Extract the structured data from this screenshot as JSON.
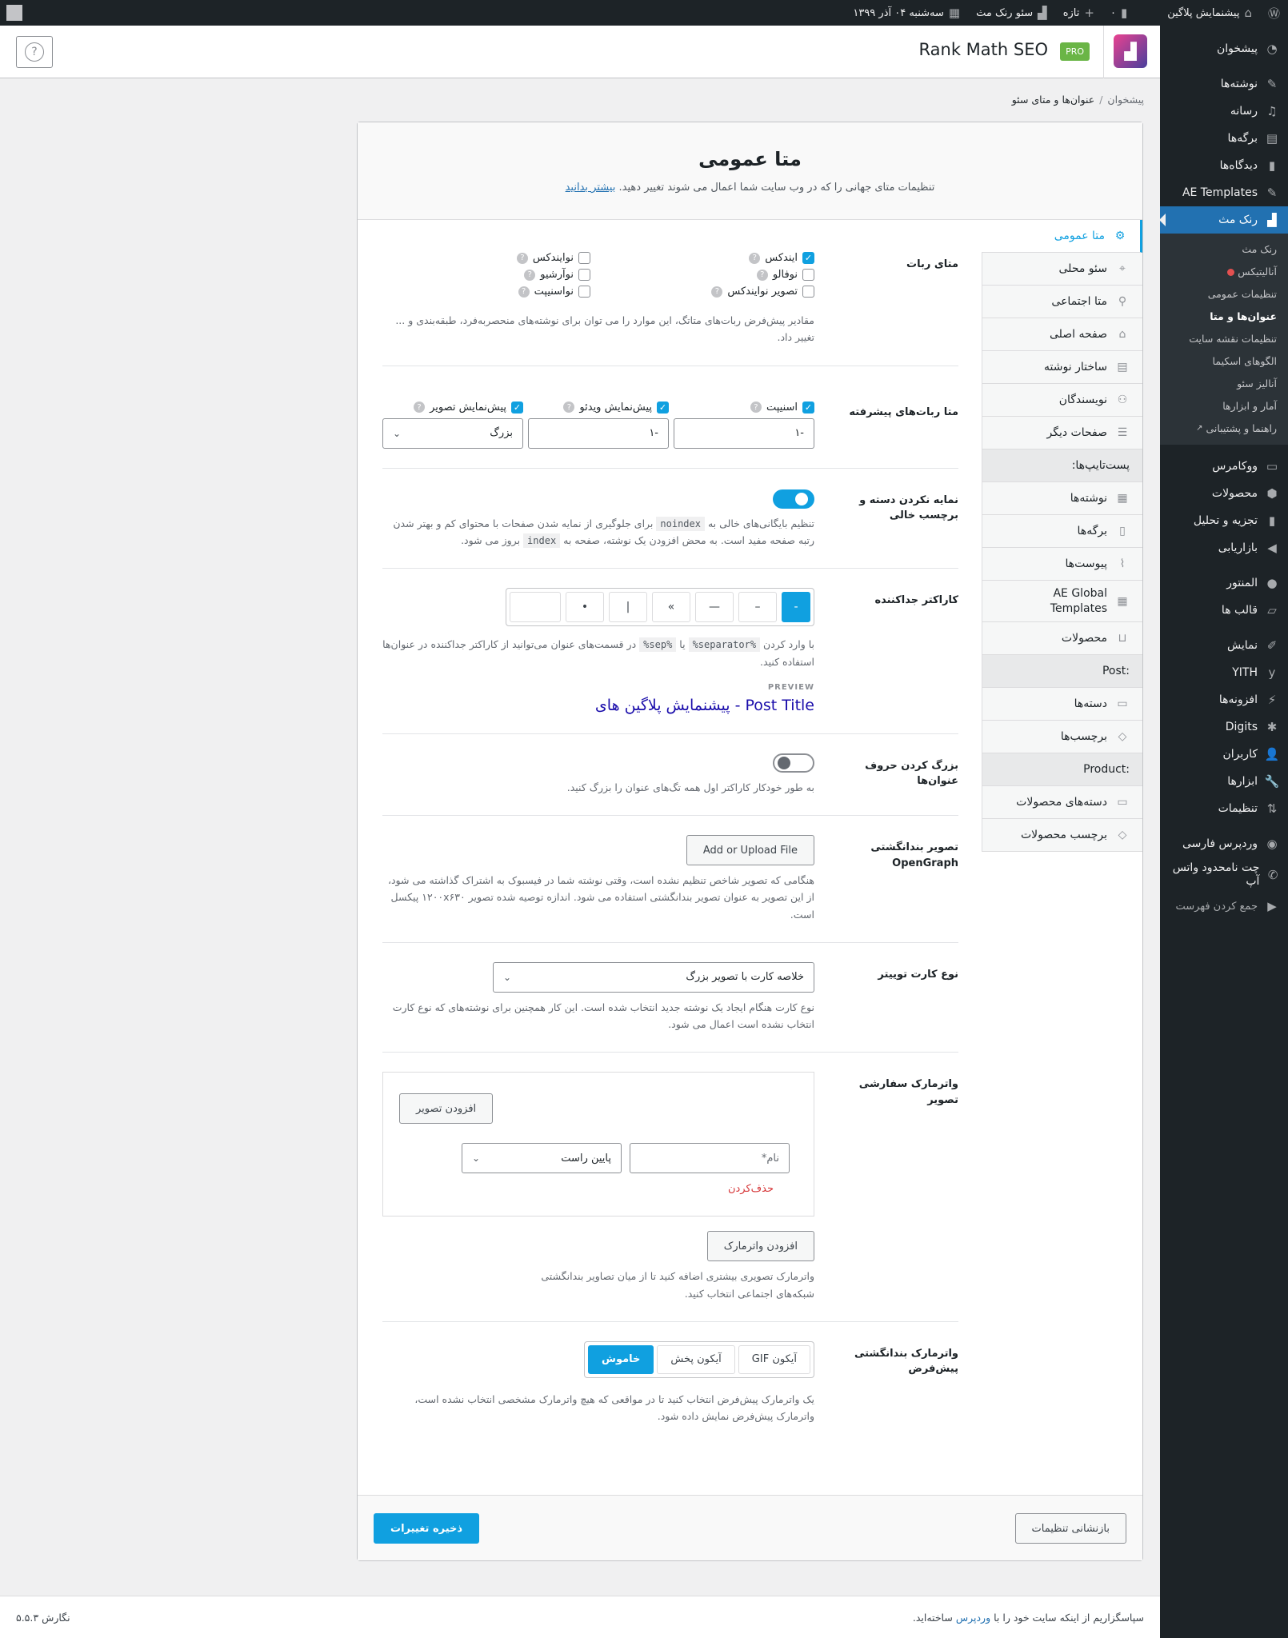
{
  "adminbar": {
    "site_name": "پیشنمایش پلاگین",
    "comments_count": "۰",
    "new_label": "تازه",
    "rankmath_label": "سئو رنک مث",
    "date": "سه‌شنبه ۰۴ آذر ۱۳۹۹"
  },
  "header": {
    "title": "Rank Math SEO",
    "badge": "PRO",
    "help": "?"
  },
  "breadcrumb": {
    "home": "پیشخوان",
    "separator": "/",
    "current": "عنوان‌ها و متای سئو"
  },
  "panel": {
    "title": "متا عمومی",
    "description": "تنظیمات متای جهانی را که در وب سایت شما اعمال می شوند تغییر دهید.",
    "learn_more": "بیشتر بدانید"
  },
  "tabs": [
    {
      "label": "متا عمومی",
      "icon": "gear",
      "active": true
    },
    {
      "label": "سئو محلی",
      "icon": "location"
    },
    {
      "label": "متا اجتماعی",
      "icon": "social"
    },
    {
      "label": "صفحه اصلی",
      "icon": "home"
    },
    {
      "label": "ساختار نوشته",
      "icon": "document"
    },
    {
      "label": "نویسندگان",
      "icon": "users"
    },
    {
      "label": "صفحات دیگر",
      "icon": "list"
    },
    {
      "label": "پست‌تایپ‌ها:",
      "group": true
    },
    {
      "label": "نوشته‌ها",
      "icon": "post"
    },
    {
      "label": "برگه‌ها",
      "icon": "page"
    },
    {
      "label": "پیوست‌ها",
      "icon": "paperclip"
    },
    {
      "label": "AE Global Templates",
      "icon": "post"
    },
    {
      "label": "محصولات",
      "icon": "cart"
    },
    {
      "label": ":Post",
      "group": true
    },
    {
      "label": "دسته‌ها",
      "icon": "folder"
    },
    {
      "label": "برچسب‌ها",
      "icon": "tag"
    },
    {
      "label": ":Product",
      "group": true
    },
    {
      "label": "دسته‌های محصولات",
      "icon": "folder"
    },
    {
      "label": "برچسب محصولات",
      "icon": "tag"
    }
  ],
  "fields": {
    "robots": {
      "label": "متای ربات",
      "options": [
        {
          "label": "ایندکس",
          "checked": true
        },
        {
          "label": "نوایندکس",
          "checked": false
        },
        {
          "label": "نوفالو",
          "checked": false
        },
        {
          "label": "نوآرشیو",
          "checked": false
        },
        {
          "label": "تصویر نوایندکس",
          "checked": false
        },
        {
          "label": "نواسنیپت",
          "checked": false
        }
      ],
      "description": "مقادیر پیش‌فرض ربات‌های متاتگ، این موارد را می توان برای نوشته‌های منحصربه‌فرد، طبقه‌بندی و ... تغییر داد."
    },
    "advanced": {
      "label": "متا ربات‌های پیشرفته",
      "snippet": {
        "label": "اسنیپت",
        "checked": true,
        "value": "-۱"
      },
      "video": {
        "label": "پیش‌نمایش ویدئو",
        "checked": true,
        "value": "-۱"
      },
      "image": {
        "label": "پیش‌نمایش تصویر",
        "checked": true,
        "value": "بزرگ"
      }
    },
    "noindex_empty": {
      "label": "نمایه نکردن دسته و برچسب خالی",
      "enabled": true,
      "desc_pre": "تنظیم بایگانی‌های خالی به",
      "code1": "noindex",
      "desc_mid": "برای جلوگیری از نمایه شدن صفحات با محتوای کم و بهتر شدن رتبه صفحه مفید است. به محض افزودن یک نوشته، صفحه به",
      "code2": "index",
      "desc_post": "بروز می شود."
    },
    "separator": {
      "label": "کاراکتر جداکننده",
      "options": [
        "-",
        "–",
        "—",
        "»",
        "|",
        "•",
        ""
      ],
      "selected": "-",
      "desc_pre": "با وارد کردن",
      "code1": "%separator%",
      "desc_or": "یا",
      "code2": "%sep%",
      "desc_post": "در قسمت‌های عنوان می‌توانید از کاراکتر جداکننده در عنوان‌ها استفاده کنید.",
      "preview_label": "PREVIEW",
      "preview_title": "Post Title - پیشنمایش پلاگین های"
    },
    "capitalize": {
      "label": "بزرگ کردن حروف عنوان‌ها",
      "enabled": false,
      "description": "به طور خودکار کاراکتر اول همه تگ‌های عنوان را بزرگ کنید."
    },
    "opengraph": {
      "label": "تصویر بندانگشتی OpenGraph",
      "button": "Add or Upload File",
      "description": "هنگامی که تصویر شاخص تنظیم نشده است، وقتی نوشته شما در فیسبوک به اشتراک گذاشته می شود، از این تصویر به عنوان تصویر بندانگشتی استفاده می شود. اندازه توصیه شده تصویر ۱۲۰۰x۶۳۰ پیکسل است."
    },
    "twitter": {
      "label": "نوع کارت توییتر",
      "value": "خلاصه کارت با تصویر بزرگ",
      "description": "نوع کارت هنگام ایجاد یک نوشته جدید انتخاب شده است. این کار همچنین برای نوشته‌های که نوع کارت انتخاب نشده است اعمال می شود."
    },
    "watermark": {
      "label": "واترمارک سفارشی تصویر",
      "add_image": "افزودن تصویر",
      "name_placeholder": "نام*",
      "position": "پایین راست",
      "delete": "حذف‌کردن",
      "add_watermark": "افزودن واترمارک",
      "description": "واترمارک تصویری بیشتری اضافه کنید تا از میان تصاویر بندانگشتی شبکه‌های اجتماعی انتخاب کنید."
    },
    "default_watermark": {
      "label": "واترمارک بندانگشتی پیش‌فرض",
      "options": [
        "آیکون GIF",
        "آیکون پخش",
        "خاموش"
      ],
      "selected": "خاموش",
      "description": "یک واترمارک پیش‌فرض انتخاب کنید تا در مواقعی که هیچ واترمارک مشخصی انتخاب نشده است، واترمارک پیش‌فرض نمایش داده شود."
    }
  },
  "footer_buttons": {
    "reset": "بازنشانی تنظیمات",
    "save": "ذخیره تغییرات"
  },
  "wp_footer": {
    "thanks_pre": "سپاسگزاریم از اینکه سایت خود را با",
    "wp_link": "وردپرس",
    "thanks_post": "ساخته‌اید.",
    "version": "نگارش ۵.۵.۳"
  },
  "sidebar": {
    "group1": [
      {
        "label": "پیشخوان",
        "icon": "dashboard"
      },
      {
        "label": "نوشته‌ها",
        "icon": "pin"
      },
      {
        "label": "رسانه",
        "icon": "media"
      },
      {
        "label": "برگه‌ها",
        "icon": "pages"
      },
      {
        "label": "دیدگاه‌ها",
        "icon": "comment"
      },
      {
        "label": "AE Templates",
        "icon": "pin"
      },
      {
        "label": "رنک مث",
        "icon": "rankmath",
        "current": true
      }
    ],
    "rankmath_sub": [
      {
        "label": "رنک مث"
      },
      {
        "label": "آنالیتیکس",
        "dot": true
      },
      {
        "label": "تنظیمات عمومی"
      },
      {
        "label": "عنوان‌ها و متا",
        "current": true
      },
      {
        "label": "تنظیمات نقشه سایت"
      },
      {
        "label": "الگوهای اسکیما"
      },
      {
        "label": "آنالیز سئو"
      },
      {
        "label": "آمار و ابزارها"
      },
      {
        "label": "راهنما و پشتیبانی",
        "external": true
      }
    ],
    "group2": [
      {
        "label": "ووکامرس",
        "icon": "woo"
      },
      {
        "label": "محصولات",
        "icon": "box"
      },
      {
        "label": "تجزیه و تحلیل",
        "icon": "chart"
      },
      {
        "label": "بازاریابی",
        "icon": "megaphone"
      },
      {
        "label": "المنتور",
        "icon": "elementor"
      },
      {
        "label": "قالب ها",
        "icon": "folder"
      },
      {
        "label": "نمایش",
        "icon": "brush"
      },
      {
        "label": "YITH",
        "icon": "yith"
      },
      {
        "label": "افزونه‌ها",
        "icon": "plug"
      },
      {
        "label": "Digits",
        "icon": "asterisk"
      },
      {
        "label": "کاربران",
        "icon": "user"
      },
      {
        "label": "ابزارها",
        "icon": "wrench"
      },
      {
        "label": "تنظیمات",
        "icon": "settings"
      },
      {
        "label": "وردپرس فارسی",
        "icon": "wpfa"
      },
      {
        "label": "چت نامحدود واتس آپ",
        "icon": "whatsapp"
      },
      {
        "label": "جمع کردن فهرست",
        "icon": "collapse"
      }
    ]
  }
}
